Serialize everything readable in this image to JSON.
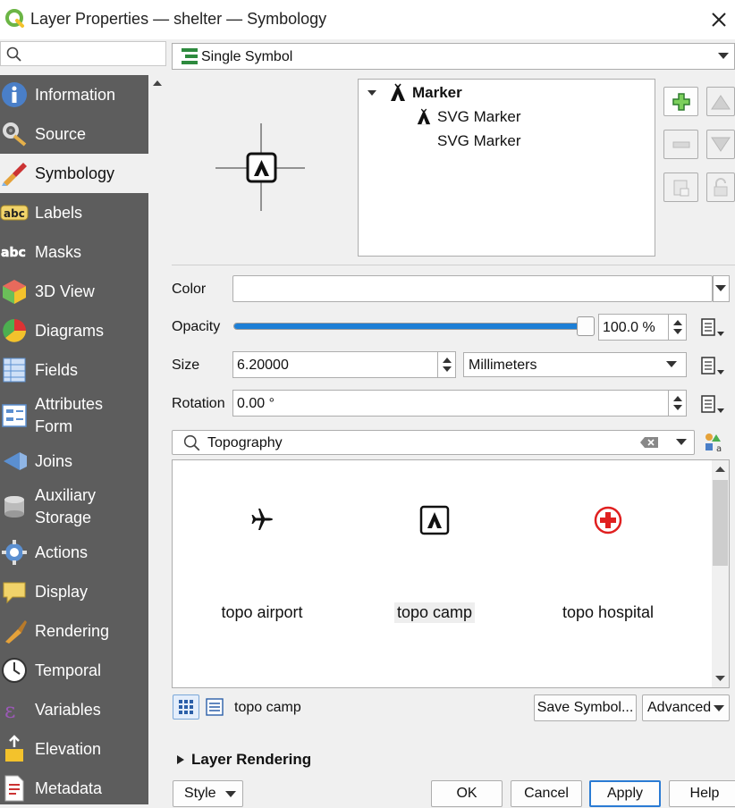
{
  "window": {
    "title": "Layer Properties — shelter — Symbology"
  },
  "search": {
    "placeholder": ""
  },
  "sidebar": {
    "items": [
      {
        "label": "Information",
        "icon": "information-icon"
      },
      {
        "label": "Source",
        "icon": "source-icon"
      },
      {
        "label": "Symbology",
        "icon": "symbology-icon",
        "selected": true
      },
      {
        "label": "Labels",
        "icon": "labels-icon"
      },
      {
        "label": "Masks",
        "icon": "masks-icon"
      },
      {
        "label": "3D View",
        "icon": "3d-view-icon"
      },
      {
        "label": "Diagrams",
        "icon": "diagrams-icon"
      },
      {
        "label": "Fields",
        "icon": "fields-icon"
      },
      {
        "label": "Attributes\nForm",
        "icon": "attributes-form-icon"
      },
      {
        "label": "Joins",
        "icon": "joins-icon"
      },
      {
        "label": "Auxiliary\nStorage",
        "icon": "auxiliary-storage-icon"
      },
      {
        "label": "Actions",
        "icon": "actions-icon"
      },
      {
        "label": "Display",
        "icon": "display-icon"
      },
      {
        "label": "Rendering",
        "icon": "rendering-icon"
      },
      {
        "label": "Temporal",
        "icon": "temporal-icon"
      },
      {
        "label": "Variables",
        "icon": "variables-icon"
      },
      {
        "label": "Elevation",
        "icon": "elevation-icon"
      },
      {
        "label": "Metadata",
        "icon": "metadata-icon"
      }
    ]
  },
  "renderer": {
    "selected": "Single Symbol"
  },
  "symbol_tree": {
    "root": "Marker",
    "layers": [
      "SVG Marker",
      "SVG Marker"
    ]
  },
  "properties": {
    "color_label": "Color",
    "opacity_label": "Opacity",
    "opacity_value": "100.0 %",
    "opacity_fraction": 1.0,
    "size_label": "Size",
    "size_value": "6.20000",
    "size_unit": "Millimeters",
    "rotation_label": "Rotation",
    "rotation_value": "0.00 °"
  },
  "library": {
    "search_value": "Topography",
    "symbols": [
      {
        "name": "topo airport",
        "icon": "airplane-icon"
      },
      {
        "name": "topo camp",
        "icon": "tent-icon",
        "selected": true
      },
      {
        "name": "topo hospital",
        "icon": "hospital-cross-icon"
      }
    ],
    "selected_name": "topo camp",
    "save_label": "Save Symbol...",
    "advanced_label": "Advanced"
  },
  "layer_rendering": {
    "label": "Layer Rendering"
  },
  "footer": {
    "style_label": "Style",
    "ok_label": "OK",
    "cancel_label": "Cancel",
    "apply_label": "Apply",
    "help_label": "Help"
  },
  "colors": {
    "sidebar_bg": "#5d5d5d",
    "slider_blue": "#1d7fd6",
    "renderer_icon_green": "#2d8a3e",
    "add_green": "#3a9a3a",
    "hospital_red": "#e02020"
  }
}
